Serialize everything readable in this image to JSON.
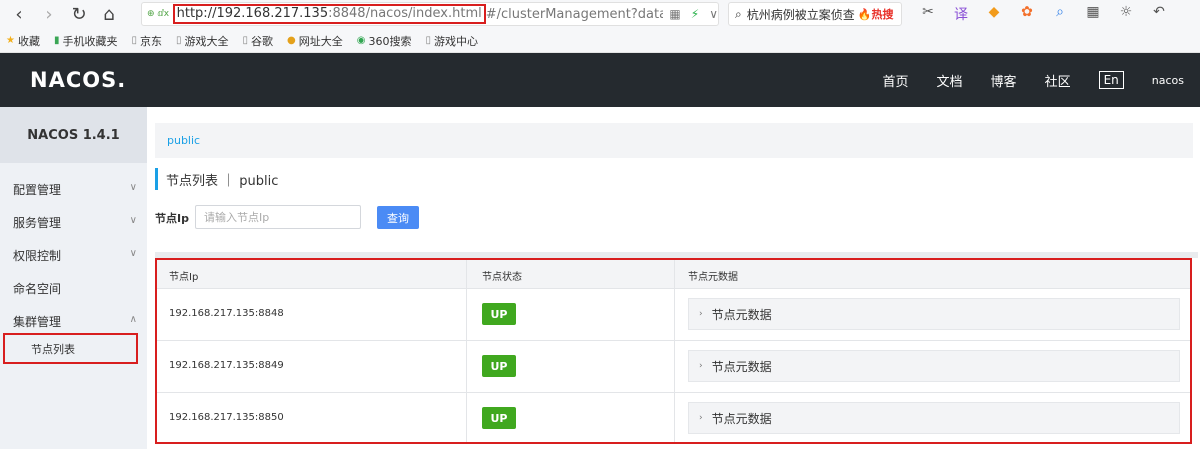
{
  "browser": {
    "url_highlight": "http://192.168.217.135",
    "url_highlight_dim": ":8848/nacos/index.html",
    "url_rest": "#/clusterManagement?dataId=&grou",
    "url_prefix": "⊕ ⅆx",
    "search_text": "杭州病例被立案侦查",
    "search_hot": "🔥热搜"
  },
  "bookmarks": [
    {
      "label": "收藏",
      "icon": "star-icon"
    },
    {
      "label": "手机收藏夹",
      "icon": "phone-icon"
    },
    {
      "label": "京东",
      "icon": "page-icon"
    },
    {
      "label": "游戏大全",
      "icon": "page-icon"
    },
    {
      "label": "谷歌",
      "icon": "page-icon"
    },
    {
      "label": "网址大全",
      "icon": "globe-icon"
    },
    {
      "label": "360搜索",
      "icon": "circle-icon"
    },
    {
      "label": "游戏中心",
      "icon": "page-icon"
    }
  ],
  "header": {
    "logo": "NACOS.",
    "nav": [
      "首页",
      "文档",
      "博客",
      "社区"
    ],
    "lang": "En",
    "user": "nacos"
  },
  "sidebar": {
    "title": "NACOS 1.4.1",
    "items": [
      {
        "label": "配置管理",
        "chevron": "∨"
      },
      {
        "label": "服务管理",
        "chevron": "∨"
      },
      {
        "label": "权限控制",
        "chevron": "∨"
      },
      {
        "label": "命名空间",
        "chevron": ""
      },
      {
        "label": "集群管理",
        "chevron": "∧"
      }
    ],
    "sub_item": "节点列表"
  },
  "main": {
    "namespace_tab": "public",
    "section_title": "节点列表 ｜ public",
    "filter_label": "节点Ip",
    "filter_placeholder": "请输入节点Ip",
    "query_button": "查询",
    "columns": [
      "节点Ip",
      "节点状态",
      "节点元数据"
    ],
    "rows": [
      {
        "ip": "192.168.217.135:8848",
        "status": "UP",
        "meta": "节点元数据"
      },
      {
        "ip": "192.168.217.135:8849",
        "status": "UP",
        "meta": "节点元数据"
      },
      {
        "ip": "192.168.217.135:8850",
        "status": "UP",
        "meta": "节点元数据"
      }
    ]
  },
  "colors": {
    "header_bg": "#252a2f",
    "accent_blue": "#1aa0e6",
    "query_btn": "#4b8bf5",
    "status_up": "#40a81f",
    "highlight_red": "#d81e1e"
  }
}
